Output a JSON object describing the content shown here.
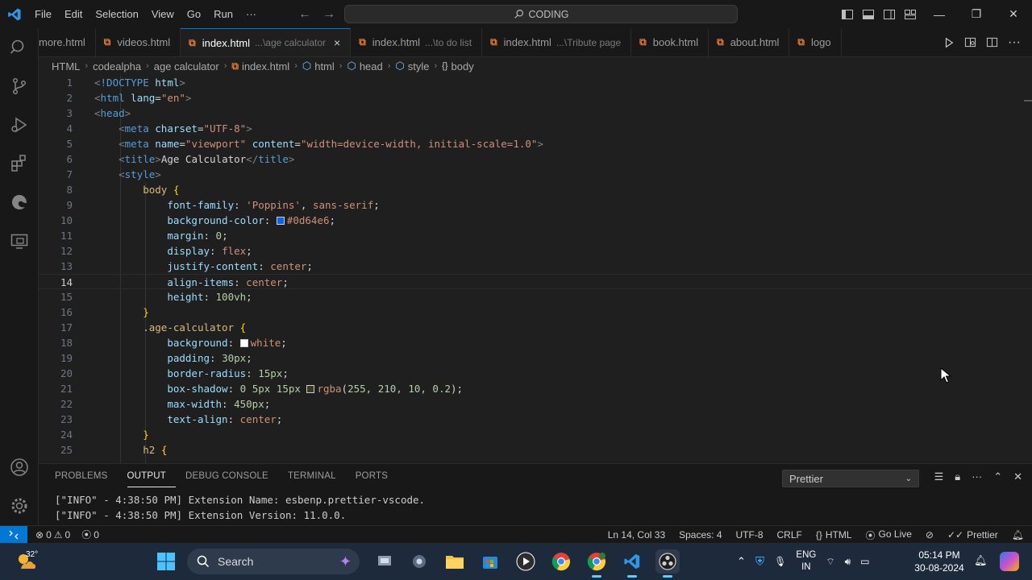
{
  "menu": [
    "File",
    "Edit",
    "Selection",
    "View",
    "Go",
    "Run",
    "···"
  ],
  "command_center": "CODING",
  "tabs": [
    {
      "label": "more.html",
      "desc": "",
      "active": false,
      "close": ""
    },
    {
      "label": "videos.html",
      "desc": "",
      "active": false,
      "close": ""
    },
    {
      "label": "index.html",
      "desc": "...\\age calculator",
      "active": true,
      "close": "×"
    },
    {
      "label": "index.html",
      "desc": "...\\to do list",
      "active": false,
      "close": ""
    },
    {
      "label": "index.html",
      "desc": "...\\Tribute page",
      "active": false,
      "close": ""
    },
    {
      "label": "book.html",
      "desc": "",
      "active": false,
      "close": ""
    },
    {
      "label": "about.html",
      "desc": "",
      "active": false,
      "close": ""
    },
    {
      "label": "logo",
      "desc": "",
      "active": false,
      "close": ""
    }
  ],
  "breadcrumb": [
    "HTML",
    "codealpha",
    "age calculator",
    "index.html",
    "html",
    "head",
    "style",
    "body"
  ],
  "editor": {
    "current_line": 14,
    "lines": [
      {
        "n": "1",
        "code": [
          [
            "p",
            "<"
          ],
          [
            "t",
            "!DOCTYPE"
          ],
          [
            "x",
            " "
          ],
          [
            "a",
            "html"
          ],
          [
            "p",
            ">"
          ]
        ]
      },
      {
        "n": "2",
        "code": [
          [
            "p",
            "<"
          ],
          [
            "t",
            "html"
          ],
          [
            "x",
            " "
          ],
          [
            "a",
            "lang"
          ],
          [
            "x",
            "="
          ],
          [
            "s",
            "\"en\""
          ],
          [
            "p",
            ">"
          ]
        ]
      },
      {
        "n": "3",
        "code": [
          [
            "p",
            "<"
          ],
          [
            "t",
            "head"
          ],
          [
            "p",
            ">"
          ]
        ]
      },
      {
        "n": "4",
        "code": [
          [
            "x",
            "    "
          ],
          [
            "p",
            "<"
          ],
          [
            "t",
            "meta"
          ],
          [
            "x",
            " "
          ],
          [
            "a",
            "charset"
          ],
          [
            "x",
            "="
          ],
          [
            "s",
            "\"UTF-8\""
          ],
          [
            "p",
            ">"
          ]
        ]
      },
      {
        "n": "5",
        "code": [
          [
            "x",
            "    "
          ],
          [
            "p",
            "<"
          ],
          [
            "t",
            "meta"
          ],
          [
            "x",
            " "
          ],
          [
            "a",
            "name"
          ],
          [
            "x",
            "="
          ],
          [
            "s",
            "\"viewport\""
          ],
          [
            "x",
            " "
          ],
          [
            "a",
            "content"
          ],
          [
            "x",
            "="
          ],
          [
            "s",
            "\"width=device-width, initial-scale=1.0\""
          ],
          [
            "p",
            ">"
          ]
        ]
      },
      {
        "n": "6",
        "code": [
          [
            "x",
            "    "
          ],
          [
            "p",
            "<"
          ],
          [
            "t",
            "title"
          ],
          [
            "p",
            ">"
          ],
          [
            "x",
            "Age Calculator"
          ],
          [
            "p",
            "</"
          ],
          [
            "t",
            "title"
          ],
          [
            "p",
            ">"
          ]
        ]
      },
      {
        "n": "7",
        "code": [
          [
            "x",
            "    "
          ],
          [
            "p",
            "<"
          ],
          [
            "t",
            "style"
          ],
          [
            "p",
            ">"
          ]
        ]
      },
      {
        "n": "8",
        "code": [
          [
            "x",
            "        "
          ],
          [
            "sel",
            "body"
          ],
          [
            "x",
            " "
          ],
          [
            "b",
            "{"
          ]
        ]
      },
      {
        "n": "9",
        "code": [
          [
            "x",
            "            "
          ],
          [
            "a",
            "font-family"
          ],
          [
            "x",
            ": "
          ],
          [
            "s",
            "'Poppins'"
          ],
          [
            "x",
            ", "
          ],
          [
            "s",
            "sans-serif"
          ],
          [
            "x",
            ";"
          ]
        ]
      },
      {
        "n": "10",
        "code": [
          [
            "x",
            "            "
          ],
          [
            "a",
            "background-color"
          ],
          [
            "x",
            ": "
          ],
          [
            "sw",
            "#0d64e6"
          ],
          [
            "s",
            "#0d64e6"
          ],
          [
            "x",
            ";"
          ]
        ]
      },
      {
        "n": "11",
        "code": [
          [
            "x",
            "            "
          ],
          [
            "a",
            "margin"
          ],
          [
            "x",
            ": "
          ],
          [
            "num",
            "0"
          ],
          [
            "x",
            ";"
          ]
        ]
      },
      {
        "n": "12",
        "code": [
          [
            "x",
            "            "
          ],
          [
            "a",
            "display"
          ],
          [
            "x",
            ": "
          ],
          [
            "s",
            "flex"
          ],
          [
            "x",
            ";"
          ]
        ]
      },
      {
        "n": "13",
        "code": [
          [
            "x",
            "            "
          ],
          [
            "a",
            "justify-content"
          ],
          [
            "x",
            ": "
          ],
          [
            "s",
            "center"
          ],
          [
            "x",
            ";"
          ]
        ]
      },
      {
        "n": "14",
        "code": [
          [
            "x",
            "            "
          ],
          [
            "a",
            "align-items"
          ],
          [
            "x",
            ": "
          ],
          [
            "s",
            "center"
          ],
          [
            "x",
            ";"
          ]
        ]
      },
      {
        "n": "15",
        "code": [
          [
            "x",
            "            "
          ],
          [
            "a",
            "height"
          ],
          [
            "x",
            ": "
          ],
          [
            "num",
            "100vh"
          ],
          [
            "x",
            ";"
          ]
        ]
      },
      {
        "n": "16",
        "code": [
          [
            "x",
            "        "
          ],
          [
            "b",
            "}"
          ]
        ]
      },
      {
        "n": "17",
        "code": [
          [
            "x",
            "        "
          ],
          [
            "sel",
            ".age-calculator"
          ],
          [
            "x",
            " "
          ],
          [
            "b",
            "{"
          ]
        ]
      },
      {
        "n": "18",
        "code": [
          [
            "x",
            "            "
          ],
          [
            "a",
            "background"
          ],
          [
            "x",
            ": "
          ],
          [
            "sw",
            "#ffffff"
          ],
          [
            "s",
            "white"
          ],
          [
            "x",
            ";"
          ]
        ]
      },
      {
        "n": "19",
        "code": [
          [
            "x",
            "            "
          ],
          [
            "a",
            "padding"
          ],
          [
            "x",
            ": "
          ],
          [
            "num",
            "30px"
          ],
          [
            "x",
            ";"
          ]
        ]
      },
      {
        "n": "20",
        "code": [
          [
            "x",
            "            "
          ],
          [
            "a",
            "border-radius"
          ],
          [
            "x",
            ": "
          ],
          [
            "num",
            "15px"
          ],
          [
            "x",
            ";"
          ]
        ]
      },
      {
        "n": "21",
        "code": [
          [
            "x",
            "            "
          ],
          [
            "a",
            "box-shadow"
          ],
          [
            "x",
            ": "
          ],
          [
            "num",
            "0 5px 15px "
          ],
          [
            "sw",
            "#3b3a1f"
          ],
          [
            "s",
            "rgba"
          ],
          [
            "x",
            "("
          ],
          [
            "num",
            "255, 210, 10, 0.2"
          ],
          [
            "x",
            ");"
          ]
        ]
      },
      {
        "n": "22",
        "code": [
          [
            "x",
            "            "
          ],
          [
            "a",
            "max-width"
          ],
          [
            "x",
            ": "
          ],
          [
            "num",
            "450px"
          ],
          [
            "x",
            ";"
          ]
        ]
      },
      {
        "n": "23",
        "code": [
          [
            "x",
            "            "
          ],
          [
            "a",
            "text-align"
          ],
          [
            "x",
            ": "
          ],
          [
            "s",
            "center"
          ],
          [
            "x",
            ";"
          ]
        ]
      },
      {
        "n": "24",
        "code": [
          [
            "x",
            "        "
          ],
          [
            "b",
            "}"
          ]
        ]
      },
      {
        "n": "25",
        "code": [
          [
            "x",
            "        "
          ],
          [
            "sel",
            "h2"
          ],
          [
            "x",
            " "
          ],
          [
            "b",
            "{"
          ]
        ]
      }
    ]
  },
  "panel": {
    "tabs": [
      "PROBLEMS",
      "OUTPUT",
      "DEBUG CONSOLE",
      "TERMINAL",
      "PORTS"
    ],
    "active_tab": "OUTPUT",
    "select_value": "Prettier",
    "output": [
      "[\"INFO\" - 4:38:50 PM] Extension Name: esbenp.prettier-vscode.",
      "[\"INFO\" - 4:38:50 PM] Extension Version: 11.0.0."
    ]
  },
  "statusbar": {
    "errors": "0",
    "warnings": "0",
    "ports": "0",
    "position": "Ln 14, Col 33",
    "spaces": "Spaces: 4",
    "encoding": "UTF-8",
    "eol": "CRLF",
    "language": "HTML",
    "go_live": "Go Live",
    "prettier": "Prettier"
  },
  "taskbar": {
    "temperature": "32°",
    "search_label": "Search",
    "lang_top": "ENG",
    "lang_bottom": "IN",
    "time": "05:14 PM",
    "date": "30-08-2024"
  },
  "colors": {
    "accent": "#0078d4",
    "editor_bg": "#1f1f1f",
    "taskbar_bg": "#1c2a3c"
  }
}
